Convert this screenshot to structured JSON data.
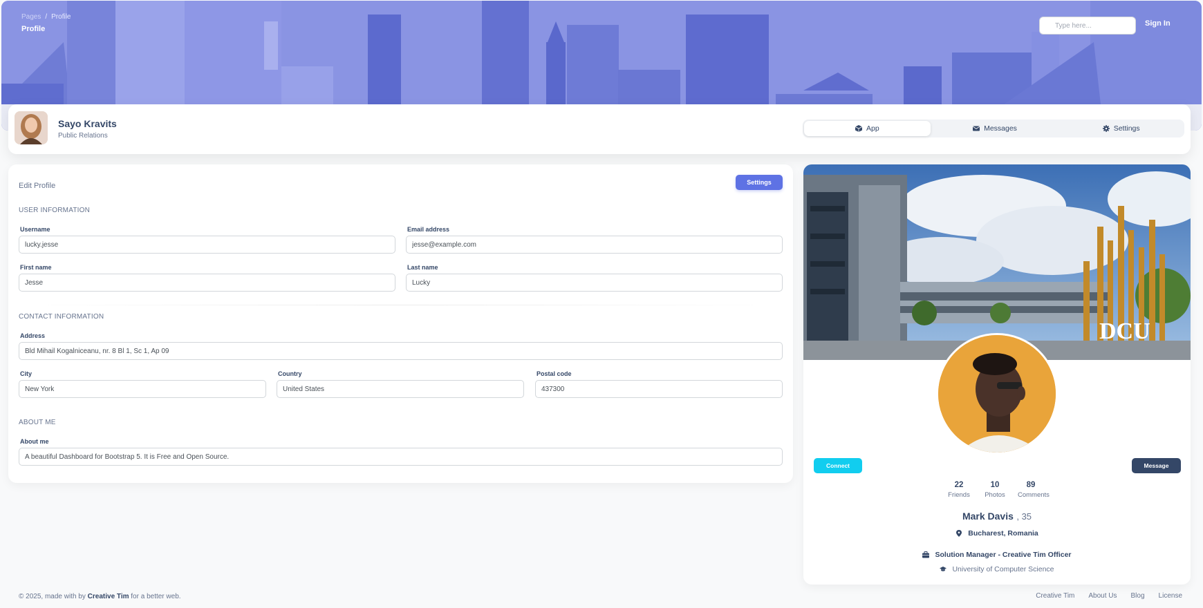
{
  "header": {
    "breadcrumb": [
      "Pages",
      "Profile"
    ],
    "title": "Profile",
    "search_placeholder": "Type here...",
    "signin_label": "Sign In"
  },
  "profile": {
    "name": "Sayo Kravits",
    "role": "Public Relations",
    "tabs": [
      {
        "label": "App",
        "icon": "cube-icon",
        "active": true
      },
      {
        "label": "Messages",
        "icon": "envelope-icon",
        "active": false
      },
      {
        "label": "Settings",
        "icon": "gear-icon",
        "active": false
      }
    ]
  },
  "edit_profile": {
    "title": "Edit Profile",
    "settings_button": "Settings",
    "sections": {
      "user_info": "User Information",
      "contact_info": "Contact Information",
      "about_me": "About me"
    },
    "fields": {
      "username": {
        "label": "Username",
        "value": "lucky.jesse"
      },
      "email": {
        "label": "Email address",
        "value": "jesse@example.com"
      },
      "first_name": {
        "label": "First name",
        "value": "Jesse"
      },
      "last_name": {
        "label": "Last name",
        "value": "Lucky"
      },
      "address": {
        "label": "Address",
        "value": "Bld Mihail Kogalniceanu, nr. 8 Bl 1, Sc 1, Ap 09"
      },
      "city": {
        "label": "City",
        "value": "New York"
      },
      "country": {
        "label": "Country",
        "value": "United States"
      },
      "postal_code": {
        "label": "Postal code",
        "value": "437300"
      },
      "about": {
        "label": "About me",
        "value": "A beautiful Dashboard for Bootstrap 5. It is Free and Open Source."
      }
    }
  },
  "card": {
    "cover_text": "DCU",
    "connect_button": "Connect",
    "message_button": "Message",
    "stats": [
      {
        "value": "22",
        "label": "Friends"
      },
      {
        "value": "10",
        "label": "Photos"
      },
      {
        "value": "89",
        "label": "Comments"
      }
    ],
    "name": "Mark Davis",
    "age": ", 35",
    "location": "Bucharest, Romania",
    "job": "Solution Manager - Creative Tim Officer",
    "education": "University of Computer Science"
  },
  "footer": {
    "prefix": "© 2025, made with by ",
    "brand": "Creative Tim",
    "suffix": " for a better web.",
    "links": [
      "Creative Tim",
      "About Us",
      "Blog",
      "License"
    ]
  },
  "colors": {
    "primary": "#5e72e4",
    "info": "#11cdef",
    "dark": "#344767",
    "banner": "#7f8ae0"
  }
}
